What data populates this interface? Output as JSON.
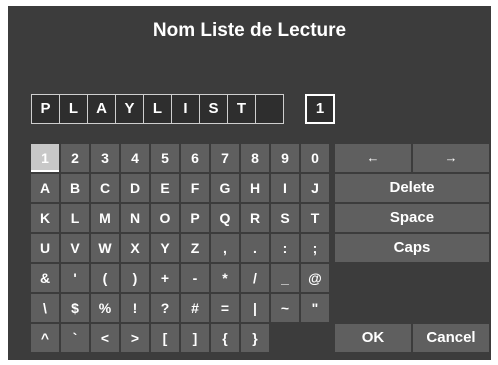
{
  "dialog": {
    "title": "Nom Liste de Lecture",
    "name_chars": [
      "P",
      "L",
      "A",
      "Y",
      "L",
      "I",
      "S",
      "T",
      "",
      "1"
    ],
    "keyboard_rows": [
      [
        "1",
        "2",
        "3",
        "4",
        "5",
        "6",
        "7",
        "8",
        "9",
        "0"
      ],
      [
        "A",
        "B",
        "C",
        "D",
        "E",
        "F",
        "G",
        "H",
        "I",
        "J"
      ],
      [
        "K",
        "L",
        "M",
        "N",
        "O",
        "P",
        "Q",
        "R",
        "S",
        "T"
      ],
      [
        "U",
        "V",
        "W",
        "X",
        "Y",
        "Z",
        ",",
        ".",
        ":",
        ";"
      ],
      [
        "&",
        "'",
        "(",
        ")",
        "+",
        "-",
        "*",
        "/",
        "_",
        "@"
      ],
      [
        "\\",
        "$",
        "%",
        "!",
        "?",
        "#",
        "=",
        "|",
        "~",
        "\""
      ],
      [
        "^",
        "`",
        "<",
        ">",
        "[",
        "]",
        "{",
        "}"
      ]
    ],
    "left_arrow": "←",
    "right_arrow": "→",
    "delete_label": "Delete",
    "space_label": "Space",
    "caps_label": "Caps",
    "ok_label": "OK",
    "cancel_label": "Cancel"
  }
}
